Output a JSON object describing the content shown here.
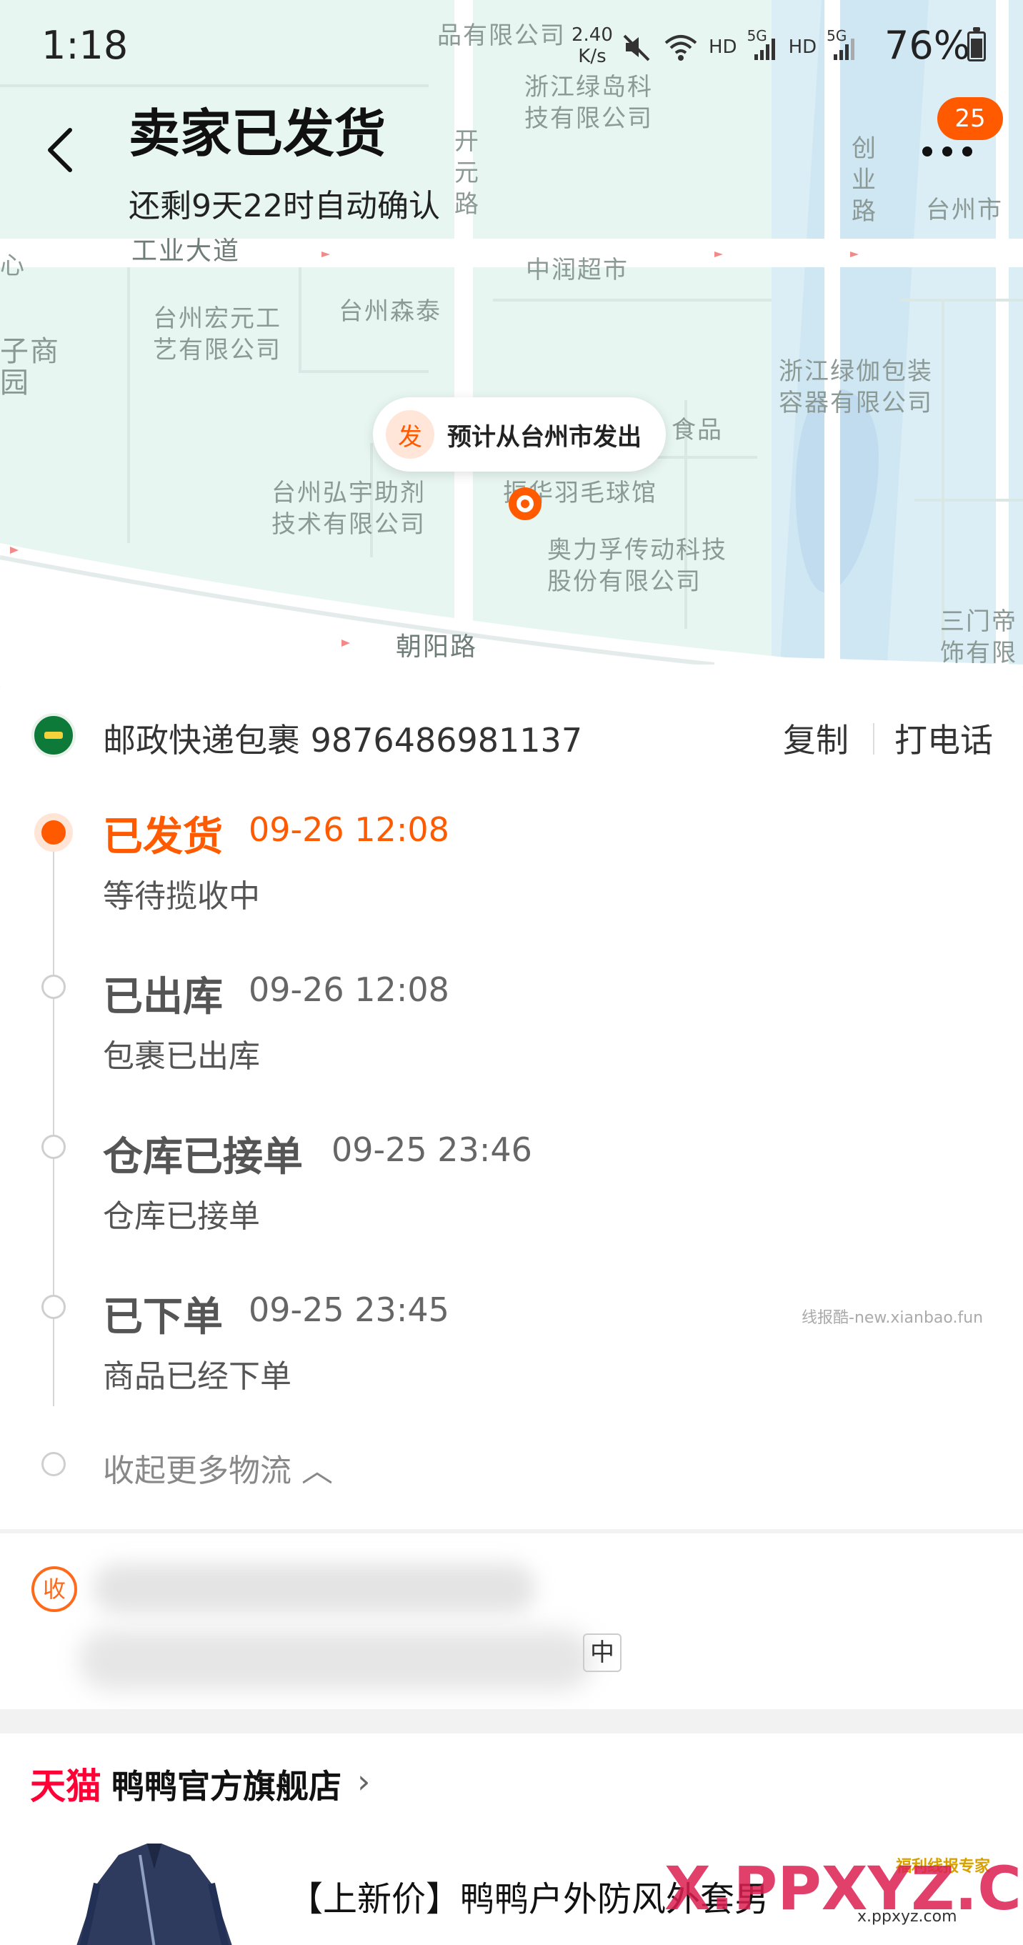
{
  "status_bar": {
    "time": "1:18",
    "net_speed": "2.40\nK/s",
    "hd1": "HD",
    "g5a": "5G",
    "hd2": "HD",
    "g5b": "5G",
    "battery": "76%"
  },
  "header": {
    "title": "卖家已发货",
    "subtitle": "还剩9天22时自动确认",
    "badge": "25"
  },
  "map": {
    "labels": [
      "品有限公司",
      "浙江绿岛科\n技有限公司",
      "开\n元\n路",
      "创\n业\n路",
      "台州市",
      "工业大道",
      "中润超市",
      "台州宏元工\n艺有限公司",
      "台州森泰",
      "子商\n园",
      "浙江绿伽包装\n容器有限公司",
      "台州弘宇助剂\n技术有限公司",
      "振华羽毛球馆",
      "奥力孚传动科技\n股份有限公司",
      "三门帝\n饰有限",
      "朝阳路",
      "食品",
      "心"
    ],
    "bubble_icon": "发",
    "bubble_text": "预计从台州市发出",
    "accent": "#ff5a00"
  },
  "logistics": {
    "carrier": "邮政快递包裹 9876486981137",
    "copy": "复制",
    "call": "打电话",
    "timeline": [
      {
        "title": "已发货",
        "time": "09-26 12:08",
        "desc": "等待揽收中"
      },
      {
        "title": "已出库",
        "time": "09-26 12:08",
        "desc": "包裹已出库"
      },
      {
        "title": "仓库已接单",
        "time": "09-25 23:46",
        "desc": "仓库已接单"
      },
      {
        "title": "已下单",
        "time": "09-25 23:45",
        "desc": "商品已经下单"
      }
    ],
    "collapse": "收起更多物流 ︿",
    "watermark": "线报酷-new.xianbao.fun"
  },
  "address": {
    "icon": "收",
    "tag": "中"
  },
  "shop": {
    "platform": "天猫",
    "name": "鸭鸭官方旗舰店",
    "chevron": "›",
    "product_title": "【上新价】鸭鸭户外防风外套男",
    "wm_main": "X.PPXYZ.COM",
    "wm_sub": "x.ppxyz.com",
    "wm_top": "福利线报专家"
  }
}
